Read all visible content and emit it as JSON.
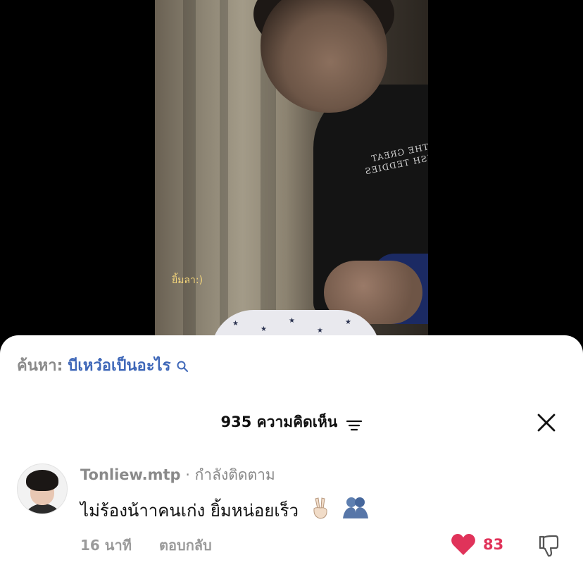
{
  "video": {
    "caption": "ยิ้มลา:)"
  },
  "search": {
    "prefix": "ค้นหา:",
    "term": "บีเหว๋อเป็นอะไร",
    "icon": "search-icon"
  },
  "comments_header": {
    "count": "935",
    "label": "ความคิดเห็น",
    "filter_icon": "filter-icon",
    "close_icon": "close-icon"
  },
  "comment": {
    "username": "Tonliew.mtp",
    "separator": " · ",
    "status": "กำลังติดตาม",
    "text": "ไม่ร้องน้าาคนเก่ง ยิ้มหน่อยเร็ว",
    "emojis": [
      "victory-hand-emoji",
      "hug-emoji"
    ],
    "time": "16 นาที",
    "reply_label": "ตอบกลับ",
    "likes": "83",
    "like_color": "#e0335a"
  }
}
